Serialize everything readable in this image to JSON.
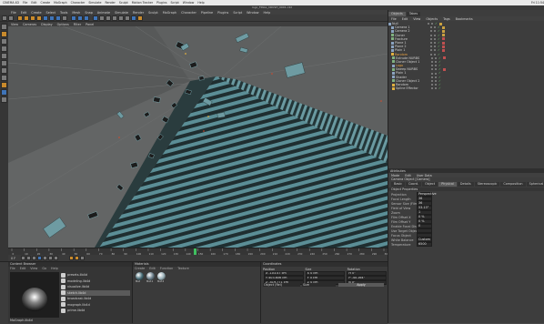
{
  "mac_menubar": {
    "items": [
      "CINEMA 4D",
      "File",
      "Edit",
      "Create",
      "MoGraph",
      "Character",
      "Simulate",
      "Render",
      "Sculpt",
      "Motion Tracker",
      "Plugins",
      "Script",
      "Window",
      "Help"
    ],
    "right": [
      "Fri 11:54"
    ]
  },
  "window_title": "logo_FINAL_CRUSH_0001.c4d",
  "app_menu": [
    "File",
    "Edit",
    "Create",
    "Select",
    "Tools",
    "Mesh",
    "Snap",
    "Animate",
    "Simulate",
    "Render",
    "Sculpt",
    "MoGraph",
    "Character",
    "Pipeline",
    "Plugins",
    "Script",
    "Window",
    "Help"
  ],
  "viewport_menu": [
    "View",
    "Cameras",
    "Display",
    "Options",
    "Filter",
    "Panel"
  ],
  "object_manager": {
    "tabs": [
      "Objects",
      "Takes"
    ],
    "menu": [
      "File",
      "Edit",
      "View",
      "Objects",
      "Tags",
      "Bookmarks"
    ],
    "objects": [
      {
        "name": "Null",
        "color": "#8aa3c0",
        "tag": "#c8a040"
      },
      {
        "name": "Camera 1",
        "color": "#8aa3c0",
        "tag": "#c8a040"
      },
      {
        "name": "Camera 2",
        "color": "#8aa3c0",
        "tag": "#c8a040"
      },
      {
        "name": "Cloner",
        "color": "#7fb07f",
        "tag": "#c8a040"
      },
      {
        "name": "Fracture",
        "color": "#7fb07f",
        "tag": "#c05050"
      },
      {
        "name": "Plane 1",
        "color": "#8aa3c0",
        "tag": "#c05050"
      },
      {
        "name": "Plane 2",
        "color": "#8aa3c0",
        "tag": "#c05050"
      },
      {
        "name": "Plain 1",
        "color": "#8aa3c0",
        "tag": "#c05050"
      },
      {
        "name": "Random",
        "color": "#e0b040",
        "tag": ""
      },
      {
        "name": "Extrude NURBS",
        "color": "#7fb07f",
        "tag": "#c05050"
      },
      {
        "name": "Cloner Object 1",
        "color": "#7fb07f",
        "tag": ""
      },
      {
        "name": "Logo",
        "color": "#8aa3c0",
        "tag": ""
      },
      {
        "name": "Sweep NURBS",
        "color": "#7fb07f",
        "tag": "#c05050"
      },
      {
        "name": "Plain 1",
        "color": "#8aa3c0",
        "tag": ""
      },
      {
        "name": "Shader",
        "color": "#8aa3c0",
        "tag": ""
      },
      {
        "name": "Cloner Object 2",
        "color": "#7fb07f",
        "tag": ""
      },
      {
        "name": "Random",
        "color": "#e0b040",
        "tag": ""
      },
      {
        "name": "Spline Effector",
        "color": "#e0b040",
        "tag": ""
      }
    ]
  },
  "attributes": {
    "header": "Attributes",
    "menu": [
      "Mode",
      "Edit",
      "User Data"
    ],
    "title": "Camera Object [Camera]",
    "tabs": [
      "Basic",
      "Coord.",
      "Object",
      "Physical",
      "Details",
      "Stereoscopic",
      "Composition",
      "Spherical"
    ],
    "section": "Object Properties",
    "rows": [
      {
        "label": "Projection",
        "value": "Perspective"
      },
      {
        "label": "Focal Length",
        "value": "36"
      },
      {
        "label": "Sensor Size (Film)",
        "value": "36"
      },
      {
        "label": "Field of View",
        "value": "53.13°"
      },
      {
        "label": "Zoom",
        "value": "1"
      },
      {
        "label": "Film Offset X",
        "value": "0 %"
      },
      {
        "label": "Film Offset Y",
        "value": "0 %"
      },
      {
        "label": "Enable Focal Distance",
        "value": "0"
      },
      {
        "label": "Use Target Object",
        "value": ""
      },
      {
        "label": "Focus Object",
        "value": ""
      },
      {
        "label": "White Balance",
        "value": "Custom"
      },
      {
        "label": "Temperature",
        "value": "6500"
      }
    ]
  },
  "content_browser": {
    "title": "Content Browser",
    "menu": [
      "File",
      "Edit",
      "View",
      "Go",
      "Help"
    ],
    "items": [
      "presets.lib4d",
      "modeling.lib4d",
      "visualize.lib4d",
      "sketch.lib4d",
      "broadcast.lib4d",
      "mograph.lib4d",
      "prime.lib4d"
    ],
    "footer": "MoGraph.lib4d"
  },
  "materials": {
    "title": "Materials",
    "menu": [
      "Create",
      "Edit",
      "Function",
      "Texture"
    ],
    "swatches": [
      {
        "name": "Mat",
        "color": "#4a6f7a"
      },
      {
        "name": "Mat.1",
        "color": "#6a7e8a"
      },
      {
        "name": "Mat.2",
        "color": "#9ab0b8"
      }
    ]
  },
  "coordinates": {
    "title": "Coordinates",
    "headers": [
      "Position",
      "Size",
      "Rotation"
    ],
    "rows": [
      [
        "X  -103.47 cm",
        "X  0 cm",
        "H  0°"
      ],
      [
        "Y  403.606 cm",
        "Y  0 cm",
        "P  -40.164°"
      ],
      [
        "Z  -419.771 cm",
        "Z  0 cm",
        "B  0°"
      ]
    ],
    "mode_left": "Object (Rel)",
    "mode_mid": "Size",
    "apply": "Apply"
  },
  "timeline": {
    "ticks": [
      "0",
      "10",
      "20",
      "30",
      "40",
      "50",
      "60",
      "70",
      "80",
      "90",
      "100",
      "110",
      "120",
      "130",
      "140",
      "150",
      "160",
      "170",
      "180",
      "190",
      "200",
      "210",
      "220",
      "230",
      "240",
      "250",
      "260",
      "270",
      "280",
      "290",
      "300"
    ],
    "current": "0 F"
  },
  "colors": {
    "accent": "#c88a2c",
    "object_text": "#cfcfcf"
  }
}
